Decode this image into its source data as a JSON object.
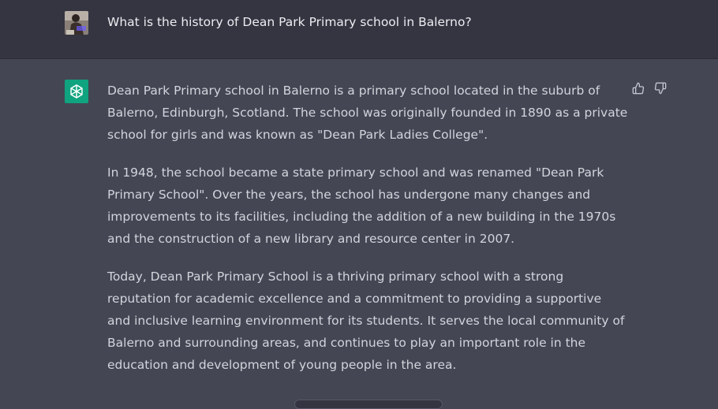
{
  "conversation": {
    "user_message": "What is the history of Dean Park Primary school in Balerno?",
    "assistant_paragraphs": [
      "Dean Park Primary school in Balerno is a primary school located in the suburb of Balerno, Edinburgh, Scotland. The school was originally founded in 1890 as a private school for girls and was known as \"Dean Park Ladies College\".",
      "In 1948, the school became a state primary school and was renamed \"Dean Park Primary School\". Over the years, the school has undergone many changes and improvements to its facilities, including the addition of a new building in the 1970s and the construction of a new library and resource center in 2007.",
      "Today, Dean Park Primary School is a thriving primary school with a strong reputation for academic excellence and a commitment to providing a supportive and inclusive learning environment for its students. It serves the local community of Balerno and surrounding areas, and continues to play an important role in the education and development of young people in the area."
    ]
  },
  "icons": {
    "user_avatar": "user-photo-avatar",
    "assistant_avatar": "openai-logo-icon",
    "thumbs_up": "thumbs-up-icon",
    "thumbs_down": "thumbs-down-icon"
  },
  "colors": {
    "user_bg": "#343541",
    "assistant_bg": "#444654",
    "accent": "#10a37f",
    "text": "#d1d5db"
  }
}
